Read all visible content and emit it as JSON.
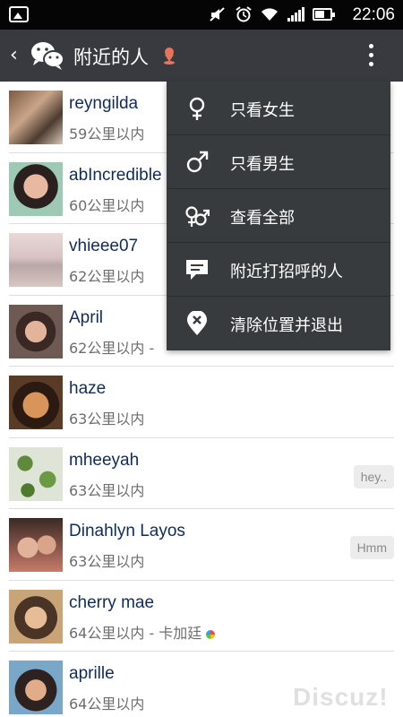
{
  "status_bar": {
    "time": "22:06",
    "icons": [
      "image-icon",
      "muted-icon",
      "alarm-icon",
      "wifi-icon",
      "signal-icon",
      "battery-icon"
    ]
  },
  "action_bar": {
    "back_label": "‹",
    "title": "附近的人",
    "icons": [
      "wechat-logo-icon",
      "location-pin-icon",
      "overflow-menu-icon"
    ]
  },
  "people": [
    {
      "name": "reyngilda",
      "distance": "59公里以内",
      "message": ""
    },
    {
      "name": "abIncredible",
      "distance": "60公里以内",
      "message": ""
    },
    {
      "name": "vhieee07",
      "distance": "62公里以内",
      "message": ""
    },
    {
      "name": "April",
      "distance": "62公里以内 - ",
      "message": ""
    },
    {
      "name": "haze",
      "distance": "63公里以内",
      "message": ""
    },
    {
      "name": "mheeyah",
      "distance": "63公里以内",
      "message": "hey.."
    },
    {
      "name": "Dinahlyn Layos",
      "distance": "63公里以内",
      "message": "Hmm"
    },
    {
      "name": "cherry mae",
      "distance": "64公里以内 - 卡加廷",
      "message": ""
    },
    {
      "name": "aprille",
      "distance": "64公里以内",
      "message": ""
    }
  ],
  "menu": {
    "items": [
      {
        "label": "只看女生",
        "icon": "female-icon"
      },
      {
        "label": "只看男生",
        "icon": "male-icon"
      },
      {
        "label": "查看全部",
        "icon": "all-genders-icon"
      },
      {
        "label": "附近打招呼的人",
        "icon": "greeting-message-icon"
      },
      {
        "label": "清除位置并退出",
        "icon": "clear-location-icon"
      }
    ]
  },
  "watermark": "Discuz!",
  "colors": {
    "status_bar": "#050505",
    "action_bar": "#393a3f",
    "menu_bg": "#373b3e",
    "name_text": "#0f2c5a",
    "distance_text": "#6d6d6d",
    "pin_accent": "#e8745c"
  }
}
